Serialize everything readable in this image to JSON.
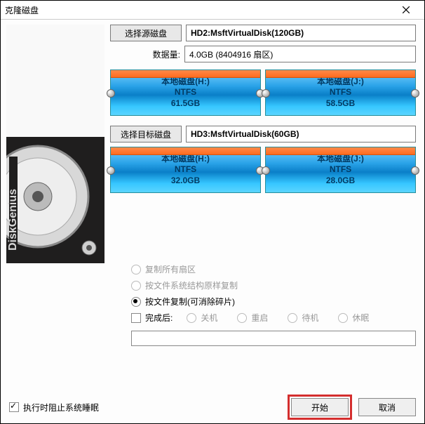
{
  "window": {
    "title": "克隆磁盘"
  },
  "source": {
    "button": "选择源磁盘",
    "disk": "HD2:MsftVirtualDisk(120GB)",
    "data_label": "数据量:",
    "data_value": "4.0GB (8404916 扇区)",
    "parts": [
      {
        "name": "本地磁盘(H:)",
        "fs": "NTFS",
        "size": "61.5GB"
      },
      {
        "name": "本地磁盘(J:)",
        "fs": "NTFS",
        "size": "58.5GB"
      }
    ]
  },
  "target": {
    "button": "选择目标磁盘",
    "disk": "HD3:MsftVirtualDisk(60GB)",
    "parts": [
      {
        "name": "本地磁盘(H:)",
        "fs": "NTFS",
        "size": "32.0GB"
      },
      {
        "name": "本地磁盘(J:)",
        "fs": "NTFS",
        "size": "28.0GB"
      }
    ]
  },
  "options": {
    "copy_all_sectors": "复制所有扇区",
    "copy_fs_structure": "按文件系统结构原样复制",
    "copy_by_file": "按文件复制(可消除碎片)",
    "after_done_label": "完成后:",
    "after_opts": {
      "shutdown": "关机",
      "restart": "重启",
      "standby": "待机",
      "hibernate": "休眠"
    }
  },
  "footer": {
    "prevent_sleep": "执行时阻止系统睡眠",
    "start": "开始",
    "cancel": "取消"
  },
  "brand": "DiskGenius"
}
